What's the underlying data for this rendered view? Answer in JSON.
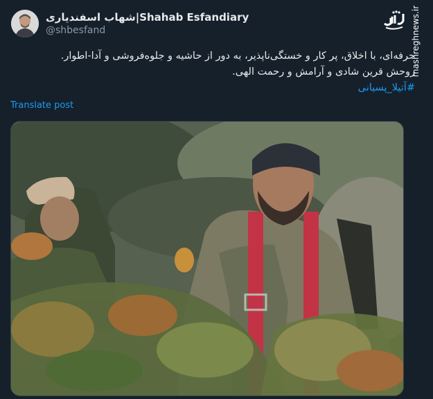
{
  "author": {
    "display_name": "شهاب اسفندیاری|Shahab Esfandiary",
    "handle": "@shbesfand"
  },
  "tweet": {
    "line1": "حرفه‌ای، با اخلاق، پر کار و خستگی‌ناپذیر، به دور از حاشیه و جلوه‌فروشی و آدا-اطوار.",
    "line2": "روحش قرین شادی و آرامش و رحمت الهی.",
    "hashtag": "#آتیلا_پسیانی"
  },
  "translate_label": "Translate post",
  "watermark": {
    "logo": "مشرق",
    "url": "mashreghnews.ir"
  },
  "colors": {
    "background": "#15202b",
    "link": "#1d9bf0",
    "secondary_text": "#8b98a5"
  }
}
